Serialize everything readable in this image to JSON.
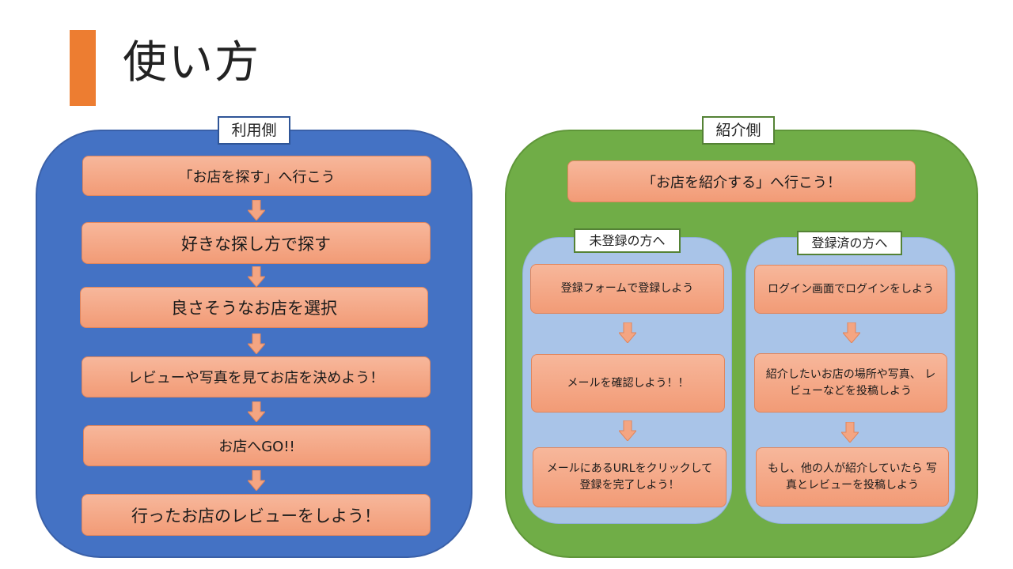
{
  "title": "使い方",
  "colors": {
    "accent_bar": "#ed7d31",
    "user_panel": "#4472c4",
    "referrer_panel": "#70ad47",
    "sub_panel": "#a9c4e8",
    "step_fill": "#f4a582",
    "arrow_fill": "#f4a582"
  },
  "user_section": {
    "label": "利用側",
    "steps": [
      "「お店を探す」へ行こう",
      "好きな探し方で探す",
      "良さそうなお店を選択",
      "レビューや写真を見てお店を決めよう！",
      "お店へGO!!",
      "行ったお店のレビューをしよう！"
    ]
  },
  "referrer_section": {
    "label": "紹介側",
    "intro": "「お店を紹介する」へ行こう！",
    "unregistered": {
      "label": "未登録の方へ",
      "steps": [
        "登録フォームで登録しよう",
        "メールを確認しよう！！",
        "メールにあるURLをクリックして 登録を完了しよう！"
      ]
    },
    "registered": {
      "label": "登録済の方へ",
      "steps": [
        "ログイン画面でログインをしよう",
        "紹介したいお店の場所や写真、 レビューなどを投稿しよう",
        "もし、他の人が紹介していたら 写真とレビューを投稿しよう"
      ]
    }
  }
}
